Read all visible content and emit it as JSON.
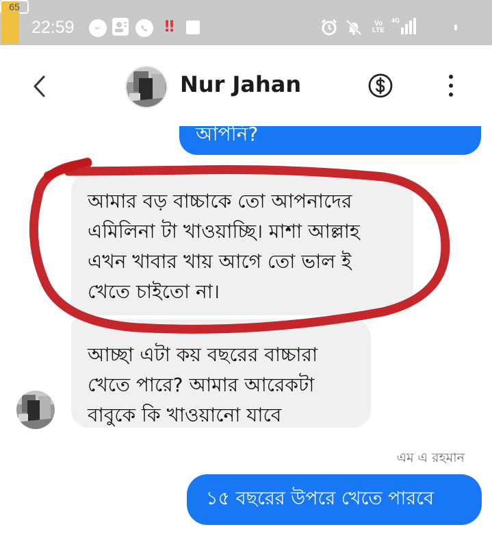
{
  "status_bar": {
    "time": "22:59",
    "icons": [
      "messenger-icon",
      "contact-card-icon",
      "viber-icon",
      "warning-icon",
      "square-icon",
      "alarm-icon",
      "mute-icon",
      "volte-icon",
      "signal-icon",
      "battery-icon"
    ],
    "warning_glyph": "‼",
    "volte_top": "Vo",
    "volte_bottom": "LTE",
    "network": "4G",
    "battery": "65"
  },
  "header": {
    "contact_name": "Nur Jahan",
    "icons": [
      "back-arrow-icon",
      "dollar-icon",
      "more-vertical-icon"
    ]
  },
  "messages": {
    "previous_outgoing": "আপনি?",
    "incoming_1": "আমার বড় বাচ্চাকে তো আপনাদের\nএমিলিনা টা খাওয়াচ্ছি। মাশা আল্লাহ\nএখন খাবার খায় আগে তো ভাল ই\nখেতে চাইতো না।",
    "incoming_2": "আচ্ছা এটা কয় বছরের বাচ্চারা\nখেতে পারে? আমার আরেকটা\nবাবুকে কি খাওয়ানো যাবে",
    "sender_label": "এম এ রহমান",
    "outgoing_reply": "১৫ বছরের উপরে খেতে পারবে"
  },
  "colors": {
    "status_bar_bg": "#c9c9c9",
    "outgoing_bubble": "#1877f2",
    "incoming_bubble": "#f0f0f0",
    "highlight": "#c0161a",
    "battery_fill": "#f0c040"
  }
}
